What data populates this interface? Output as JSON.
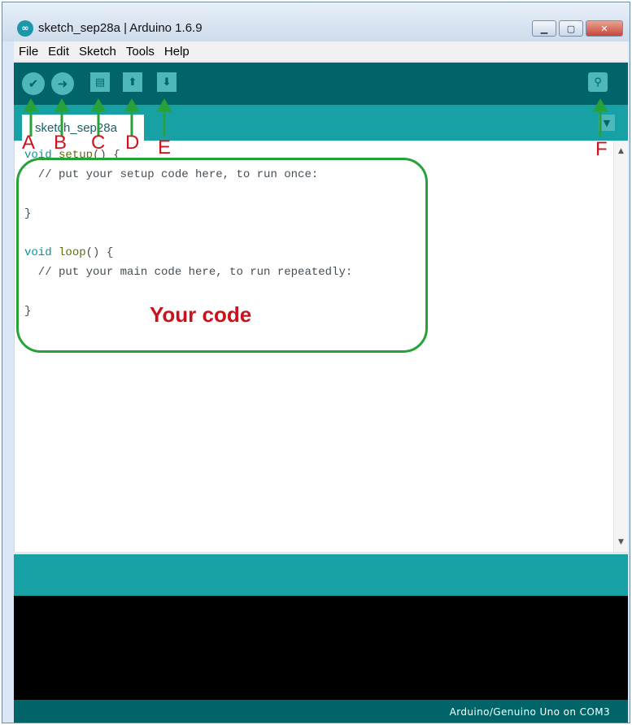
{
  "window": {
    "title": "sketch_sep28a | Arduino 1.6.9",
    "app_icon": "arduino-logo-icon",
    "controls": {
      "minimize": "minimize-icon",
      "maximize": "maximize-icon",
      "close": "close-icon"
    }
  },
  "menu": [
    "File",
    "Edit",
    "Sketch",
    "Tools",
    "Help"
  ],
  "toolbar": {
    "buttons": [
      {
        "name": "verify",
        "icon": "checkmark-icon"
      },
      {
        "name": "upload",
        "icon": "arrow-right-icon"
      },
      {
        "name": "new",
        "icon": "new-file-icon"
      },
      {
        "name": "open",
        "icon": "arrow-up-icon"
      },
      {
        "name": "save",
        "icon": "arrow-down-icon"
      },
      {
        "name": "serial-monitor",
        "icon": "magnifier-icon"
      }
    ]
  },
  "tab": {
    "label": "sketch_sep28a",
    "menu_icon": "chevron-down-icon"
  },
  "editor": {
    "lines": [
      "void setup() {",
      "  // put your setup code here, to run once:",
      "",
      "}",
      "",
      "void loop() {",
      "  // put your main code here, to run repeatedly:",
      "",
      "}"
    ]
  },
  "annotations": {
    "letters": [
      "A",
      "B",
      "C",
      "D",
      "E",
      "F"
    ],
    "code_label": "Your code",
    "arrow_color": "#27a23a",
    "label_color": "#d0131e"
  },
  "status": {
    "board": "Arduino/Genuino Uno on COM3"
  },
  "colors": {
    "toolbar_bg": "#006468",
    "tabstrip_bg": "#17a1a5",
    "button_fill": "#4db7bb",
    "console_bg": "#000000",
    "keyword": "#00979c",
    "function_name": "#5e6d03"
  }
}
